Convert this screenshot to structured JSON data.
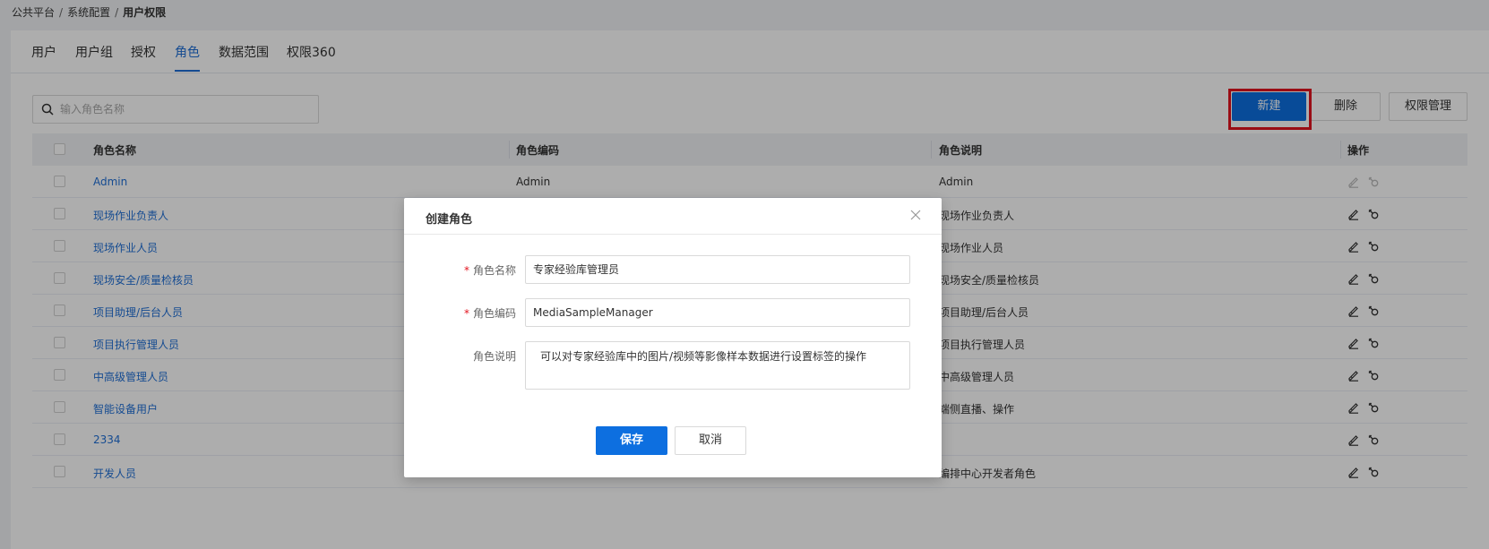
{
  "breadcrumb": {
    "item1": "公共平台",
    "item2": "系统配置",
    "item3": "用户权限",
    "sep": "/"
  },
  "tabs": [
    {
      "label": "用户"
    },
    {
      "label": "用户组"
    },
    {
      "label": "授权"
    },
    {
      "label": "角色"
    },
    {
      "label": "数据范围"
    },
    {
      "label": "权限360"
    }
  ],
  "active_tab": "角色",
  "search": {
    "placeholder": "输入角色名称",
    "value": ""
  },
  "toolbar": {
    "new_label": "新建",
    "delete_label": "删除",
    "perm_label": "权限管理"
  },
  "table": {
    "headers": {
      "name": "角色名称",
      "code": "角色编码",
      "desc": "角色说明",
      "ops": "操作"
    },
    "rows": [
      {
        "name": "Admin",
        "code": "Admin",
        "desc": "Admin"
      },
      {
        "name": "现场作业负责人",
        "code": "",
        "desc": "现场作业负责人"
      },
      {
        "name": "现场作业人员",
        "code": "",
        "desc": "现场作业人员"
      },
      {
        "name": "现场安全/质量检核员",
        "code": "",
        "desc": "现场安全/质量检核员"
      },
      {
        "name": "项目助理/后台人员",
        "code": "",
        "desc": "项目助理/后台人员"
      },
      {
        "name": "项目执行管理人员",
        "code": "",
        "desc": "项目执行管理人员"
      },
      {
        "name": "中高级管理人员",
        "code": "",
        "desc": "中高级管理人员"
      },
      {
        "name": "智能设备用户",
        "code": "",
        "desc": "端侧直播、操作"
      },
      {
        "name": "2334",
        "code": "",
        "desc": ""
      },
      {
        "name": "开发人员",
        "code": "",
        "desc": "编排中心开发者角色"
      }
    ]
  },
  "modal": {
    "title": "创建角色",
    "fields": {
      "name_label": "角色名称",
      "name_value": "专家经验库管理员",
      "code_label": "角色编码",
      "code_value": "MediaSampleManager",
      "desc_label": "角色说明",
      "desc_value": "可以对专家经验库中的图片/视频等影像样本数据进行设置标签的操作"
    },
    "required_mark": "*",
    "save_label": "保存",
    "cancel_label": "取消"
  },
  "colors": {
    "primary": "#0d6fe0",
    "link": "#1f6fd6",
    "highlight": "#e3131e"
  },
  "icons": {
    "search": "search-icon",
    "edit": "edit-icon",
    "perm": "key-icon",
    "close": "close-icon"
  }
}
